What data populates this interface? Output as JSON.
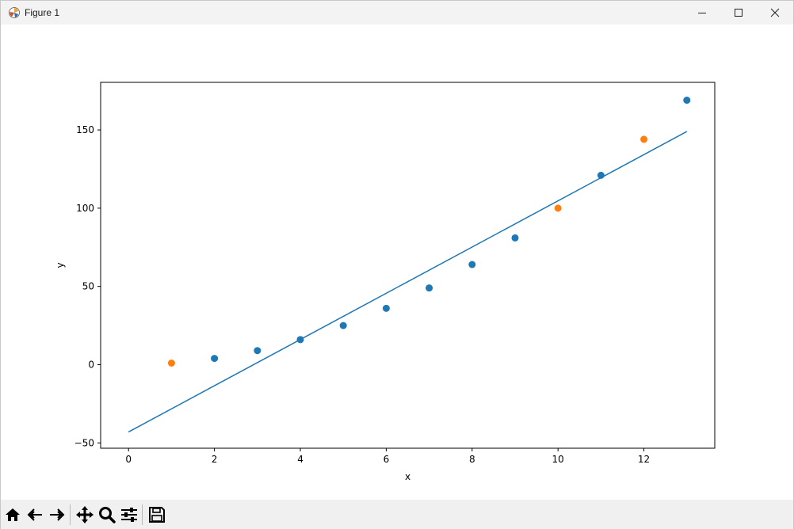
{
  "window": {
    "title": "Figure 1"
  },
  "toolbar": {
    "tools": [
      "home-icon",
      "back-icon",
      "forward-icon",
      "pan-icon",
      "zoom-icon",
      "configure-subplots-icon",
      "save-icon"
    ]
  },
  "colors": {
    "series_blue": "#1f77b4",
    "series_orange": "#ff7f0e",
    "line": "#1f77b4"
  },
  "chart_data": {
    "type": "scatter",
    "xlabel": "x",
    "ylabel": "y",
    "xlim": [
      -0.65,
      13.65
    ],
    "ylim": [
      -53.4,
      180.4
    ],
    "xticks": [
      0,
      2,
      4,
      6,
      8,
      10,
      12
    ],
    "yticks": [
      -50,
      0,
      50,
      100,
      150
    ],
    "grid": false,
    "series": [
      {
        "kind": "scatter",
        "color": "#1f77b4",
        "x": [
          2,
          3,
          4,
          5,
          6,
          7,
          8,
          9,
          11,
          13
        ],
        "y": [
          4,
          9,
          16,
          25,
          36,
          49,
          64,
          81,
          121,
          169
        ]
      },
      {
        "kind": "scatter",
        "color": "#ff7f0e",
        "x": [
          1,
          10,
          12
        ],
        "y": [
          1,
          100,
          144
        ]
      },
      {
        "kind": "line",
        "color": "#1f77b4",
        "x": [
          0,
          13
        ],
        "y": [
          -43,
          149
        ]
      }
    ]
  }
}
